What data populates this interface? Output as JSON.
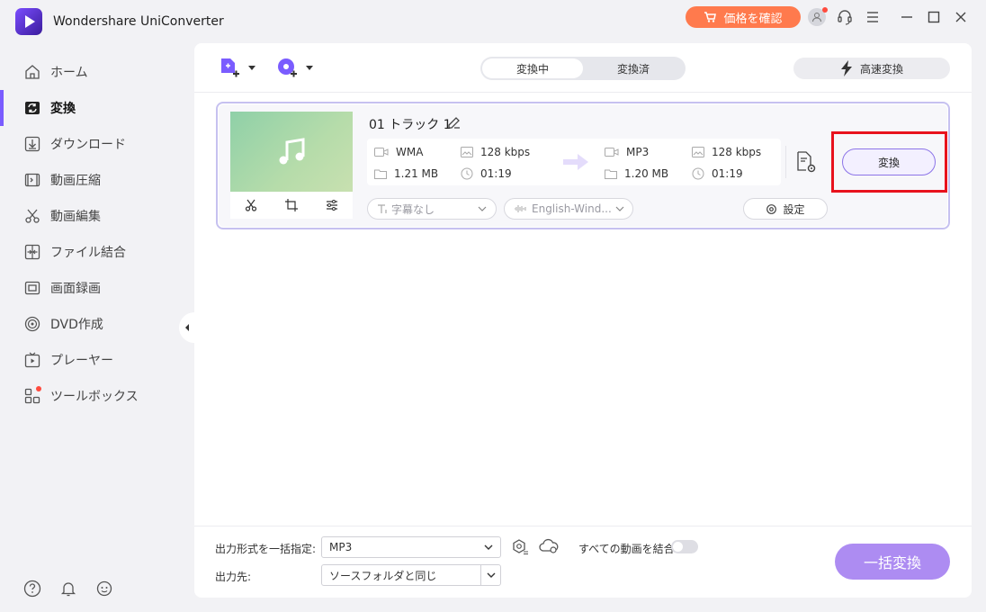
{
  "app": {
    "title": "Wondershare UniConverter",
    "price_button": "価格を確認"
  },
  "sidebar": {
    "items": [
      {
        "label": "ホーム",
        "icon": "home-icon"
      },
      {
        "label": "変換",
        "icon": "convert-icon",
        "active": true
      },
      {
        "label": "ダウンロード",
        "icon": "download-icon"
      },
      {
        "label": "動画圧縮",
        "icon": "compress-icon"
      },
      {
        "label": "動画編集",
        "icon": "scissors-icon"
      },
      {
        "label": "ファイル結合",
        "icon": "merge-icon"
      },
      {
        "label": "画面録画",
        "icon": "screen-record-icon"
      },
      {
        "label": "DVD作成",
        "icon": "dvd-icon"
      },
      {
        "label": "プレーヤー",
        "icon": "player-icon"
      },
      {
        "label": "ツールボックス",
        "icon": "toolbox-icon",
        "badge": true
      }
    ]
  },
  "toolbar": {
    "tabs": [
      "変換中",
      "変換済"
    ],
    "active_tab": "変換中",
    "speed_button": "高速変換"
  },
  "file": {
    "title": "01 トラック 1",
    "source": {
      "format": "WMA",
      "bitrate": "128 kbps",
      "size": "1.21 MB",
      "duration": "01:19"
    },
    "target": {
      "format": "MP3",
      "bitrate": "128 kbps",
      "size": "1.20 MB",
      "duration": "01:19"
    },
    "subtitle_placeholder": "字幕なし",
    "audio_track": "English-Wind...",
    "settings_button": "設定",
    "convert_button": "変換"
  },
  "bottom": {
    "output_format_label": "出力形式を一括指定:",
    "output_format_value": "MP3",
    "merge_label": "すべての動画を結合",
    "merge_enabled": false,
    "output_dest_label": "出力先:",
    "output_dest_value": "ソースフォルダと同じ",
    "batch_convert_button": "一括変換"
  },
  "colors": {
    "accent": "#7a5cff",
    "price_button": "#ff7a4d",
    "batch_button": "#ad8cf2",
    "highlight_box": "#e8121d"
  }
}
